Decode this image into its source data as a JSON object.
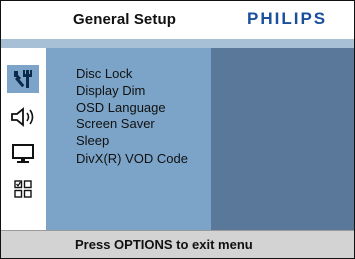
{
  "header": {
    "title": "General Setup",
    "brand": "PHILIPS"
  },
  "sidebar": {
    "icons": [
      {
        "name": "general-setup-icon",
        "selected": true
      },
      {
        "name": "audio-setup-icon",
        "selected": false
      },
      {
        "name": "video-setup-icon",
        "selected": false
      },
      {
        "name": "preferences-icon",
        "selected": false
      }
    ]
  },
  "menu": {
    "items": [
      "Disc Lock",
      "Display Dim",
      "OSD Language",
      "Screen Saver",
      "Sleep",
      "DivX(R) VOD Code"
    ]
  },
  "footer": {
    "hint": "Press OPTIONS to exit menu"
  },
  "colors": {
    "menu_bg": "#7ba4c8",
    "panel_bg": "#5a7899",
    "bar_bg": "#a7c0d6",
    "footer_bg": "#d3d3d3",
    "brand": "#1a4f9c"
  }
}
